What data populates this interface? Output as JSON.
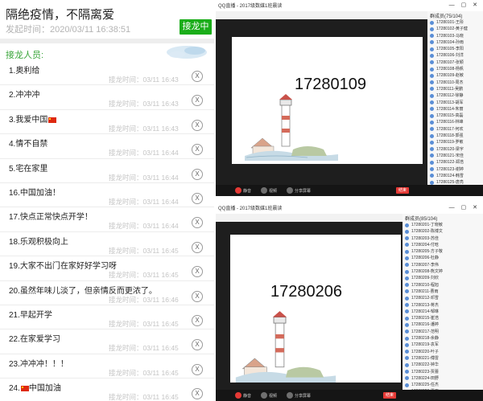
{
  "post": {
    "title": "隔绝疫情，不隔离爱",
    "time": "发起时间：2020/03/11 16:38:51",
    "button": "接龙中",
    "heading": "接龙人员:"
  },
  "entries": [
    {
      "name": "1.奥利给",
      "flag": false,
      "stamp": "接龙时间：03/11 16:43"
    },
    {
      "name": "2.冲冲冲",
      "flag": false,
      "stamp": "接龙时间：03/11 16:43"
    },
    {
      "name": "3.我爱中国",
      "flag": true,
      "stamp": "接龙时间：03/11 16:43"
    },
    {
      "name": "4.情不自禁",
      "flag": false,
      "stamp": "接龙时间：03/11 16:44"
    },
    {
      "name": "5.宅在家里",
      "flag": false,
      "stamp": "接龙时间：03/11 16:44"
    },
    {
      "name": "16.中国加油！",
      "flag": false,
      "stamp": "接龙时间：03/11 16:44"
    },
    {
      "name": "17.快点正常快点开学！",
      "flag": false,
      "stamp": "接龙时间：03/11 16:44"
    },
    {
      "name": "18.乐观积极向上",
      "flag": false,
      "stamp": "接龙时间：03/11 16:45"
    },
    {
      "name": "19.大家不出门在家好好学习呀",
      "flag": false,
      "stamp": "接龙时间：03/11 16:45"
    },
    {
      "name": "20.虽然年味儿淡了，但亲情反而更浓了。",
      "flag": false,
      "stamp": "接龙时间：03/11 16:46"
    },
    {
      "name": "21.早起开学",
      "flag": false,
      "stamp": "接龙时间：03/11 16:45"
    },
    {
      "name": "22.在家爱学习",
      "flag": false,
      "stamp": "接龙时间：03/11 16:45"
    },
    {
      "name": "23.冲冲冲！！！",
      "flag": false,
      "stamp": "接龙时间：03/11 16:45"
    },
    {
      "name": "24.",
      "flag": true,
      "name_suffix": "中国加油",
      "stamp": "接龙时间：03/11 16:45"
    }
  ],
  "remove_label": "X",
  "windows": [
    {
      "title": "QQ直播 - 2017级数媒1班晨读",
      "big_number": "17280109",
      "sidebar_head": "群成员(75/104)",
      "members": [
        "17280101-王彤",
        "17280102-黄子健",
        "17280103-马晓",
        "17280104-孙雨",
        "17280105-李阳",
        "17280106-刘洋",
        "17280107-张颖",
        "17280108-杨帆",
        "17280109-赵敏",
        "17280110-周杰",
        "17280111-吴鹏",
        "17280112-徐静",
        "17280113-胡军",
        "17280114-朱丽",
        "17280115-高磊",
        "17280116-林峰",
        "17280117-何欢",
        "17280118-郭强",
        "17280119-罗敏",
        "17280120-梁宇",
        "17280121-宋佳",
        "17280122-郑浩",
        "17280123-谢婷",
        "17280124-韩雪",
        "17280125-唐亮"
      ],
      "bar": {
        "mute": "静音",
        "video": "视频",
        "share": "分享屏幕",
        "stop": "结束"
      }
    },
    {
      "title": "QQ直播 - 2017级数媒1班晨读",
      "big_number": "17280206",
      "sidebar_head": "群成员(85/104)",
      "members": [
        "17280201-丁晓敏",
        "17280202-陈博文",
        "17280203-苏佳",
        "17280204-付晗",
        "17280205-方子敬",
        "17280206-杜静",
        "17280207-李伟",
        "17280208-熊文婷",
        "17280209-刘欣",
        "17280210-程旭",
        "17280211-曹雨",
        "17280212-邓雪",
        "17280213-蒋杰",
        "17280214-邹琳",
        "17280215-崔浩",
        "17280216-潘婷",
        "17280217-范明",
        "17280218-余静",
        "17280219-袁军",
        "17280220-叶子",
        "17280221-傅雷",
        "17280222-钟华",
        "17280223-贾蕾",
        "17280224-田野",
        "17280225-任杰",
        "17280226-夏雨",
        "17280227-姜涛",
        "17280228-秦宇"
      ],
      "bar": {
        "mute": "静音",
        "video": "视频",
        "share": "分享屏幕",
        "stop": "结束"
      }
    }
  ],
  "colors": {
    "accent": "#1aad19",
    "heading": "#39a539",
    "stop": "#e53935"
  }
}
